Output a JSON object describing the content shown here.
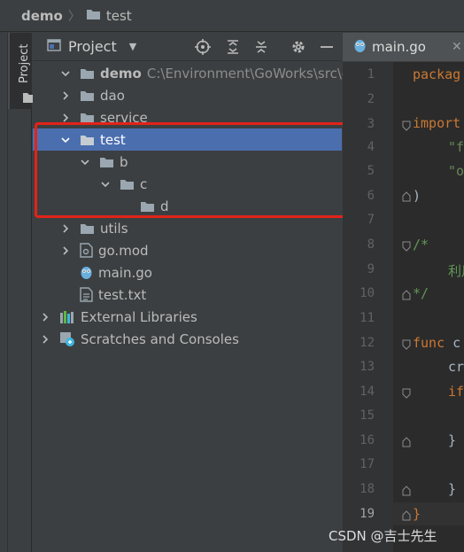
{
  "breadcrumb": {
    "root": "demo",
    "separator": "〉",
    "current": "test"
  },
  "stripe": {
    "tab_label": "Project"
  },
  "project_panel": {
    "title": "Project",
    "view_caret": "▼"
  },
  "tree": {
    "root": {
      "label": "demo",
      "path": "C:\\Environment\\GoWorks\\src\\demo"
    },
    "items": [
      {
        "label": "dao"
      },
      {
        "label": "service"
      },
      {
        "label": "test"
      },
      {
        "label": "b"
      },
      {
        "label": "c"
      },
      {
        "label": "d"
      },
      {
        "label": "utils"
      },
      {
        "label": "go.mod"
      },
      {
        "label": "main.go"
      },
      {
        "label": "test.txt"
      },
      {
        "label": "External Libraries"
      },
      {
        "label": "Scratches and Consoles"
      }
    ]
  },
  "editor": {
    "tab_label": "main.go",
    "tab_close": "✕",
    "line_numbers": [
      "1",
      "2",
      "3",
      "4",
      "5",
      "6",
      "7",
      "8",
      "9",
      "10",
      "11",
      "12",
      "13",
      "14",
      "15",
      "16",
      "17",
      "18",
      "19"
    ],
    "lines": {
      "l1": "packag",
      "l3": "import",
      "l4": "\"f",
      "l5": "\"o",
      "l6": ")",
      "l8": "/*",
      "l9": "利用",
      "l10": "*/",
      "l12_kw": "func",
      "l12_rest": "c",
      "l13": "cr",
      "l14": "if",
      "l16": "}",
      "l18": "}",
      "l19": "}"
    }
  },
  "watermark": "CSDN @吉士先生",
  "colors": {
    "selection": "#4b6eaf",
    "highlight_box": "#e2231a",
    "keyword": "#cc7832",
    "string": "#6a8759"
  }
}
